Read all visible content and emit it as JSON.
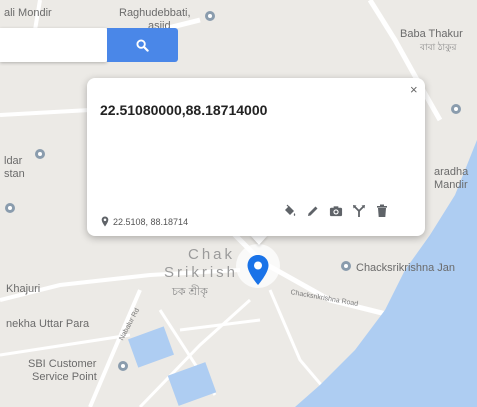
{
  "map": {
    "labels": {
      "kali_mondir": "ali Mondir",
      "raghudebbati": "Raghudebbati,",
      "masjid": "asjid",
      "baba_thakur": "Baba Thakur",
      "baba_thakur_bn": "বাবা ঠাকুর",
      "ldar": "ldar",
      "stan": "stan",
      "saradha": "aradha",
      "mandir": "Mandir",
      "chak": "Chak",
      "srikrish": "Srikrish",
      "chak_bn": "চক শ্রীকৃ",
      "chacksrikrishna": "Chacksrikrishna Jan",
      "khajuri": "Khajuri",
      "nekha_uttar_para": "nekha Uttar Para",
      "sbi_line1": "SBI Customer",
      "sbi_line2": "Service Point",
      "road_chacksrikrishna": "Chacksrikrishna Road",
      "road_nabalur": "Nabalur Rd"
    },
    "water_color": "#aecdf2",
    "land_color": "#eceae6",
    "poi_color": "#8a9cad"
  },
  "search": {
    "value": "",
    "placeholder": "",
    "button_icon": "search-icon",
    "button_color": "#4a87e8"
  },
  "popup": {
    "title": "22.51080000,88.18714000",
    "close_symbol": "×",
    "coords_short": "22.5108, 88.18714",
    "actions": [
      "paint-bucket-icon",
      "pencil-icon",
      "camera-icon",
      "directions-icon",
      "trash-icon"
    ]
  },
  "marker": {
    "color": "#1a73e8"
  }
}
